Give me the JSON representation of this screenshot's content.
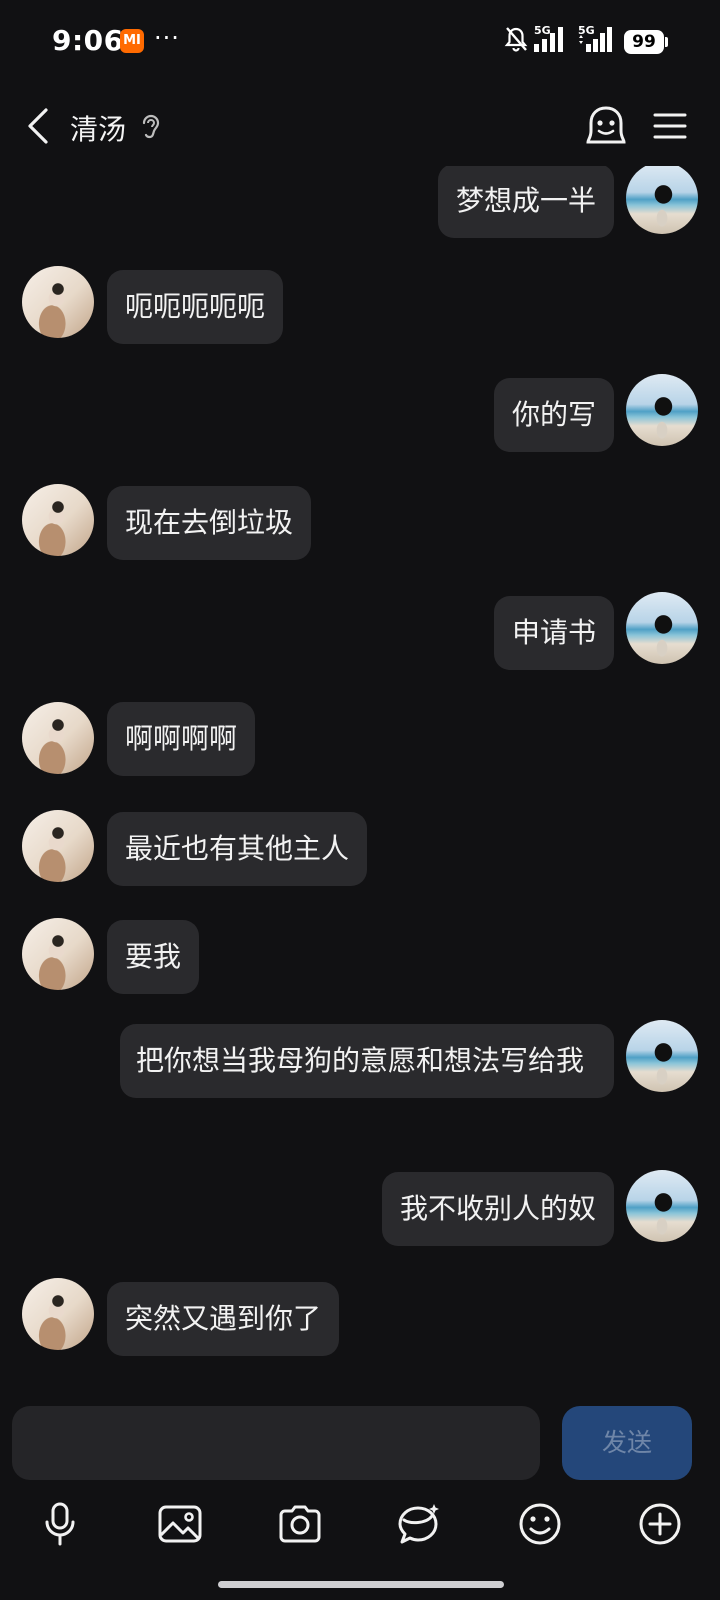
{
  "status_bar": {
    "time": "9:06",
    "carrier_badge": "MI",
    "more_indicator": "···",
    "network_1": "5G",
    "network_2": "5G",
    "battery": "99"
  },
  "header": {
    "contact_name": "清汤",
    "icons": [
      "back-arrow-icon",
      "ear-icon",
      "robot-icon",
      "menu-icon"
    ]
  },
  "messages": [
    {
      "side": "right",
      "text": "梦想成一半"
    },
    {
      "side": "left",
      "text": "呃呃呃呃呃"
    },
    {
      "side": "right",
      "text": "你的写"
    },
    {
      "side": "left",
      "text": "现在去倒垃圾"
    },
    {
      "side": "right",
      "text": "申请书"
    },
    {
      "side": "left",
      "text": "啊啊啊啊"
    },
    {
      "side": "left",
      "text": "最近也有其他主人"
    },
    {
      "side": "left",
      "text": "要我"
    },
    {
      "side": "right",
      "text": "把你想当我母狗的意愿和想法写给我"
    },
    {
      "side": "right",
      "text": "我不收别人的奴"
    },
    {
      "side": "left",
      "text": "突然又遇到你了"
    }
  ],
  "composer": {
    "input_value": "",
    "send_label": "发送"
  },
  "toolbar": {
    "icons": [
      "microphone-icon",
      "image-icon",
      "camera-icon",
      "sticker-icon",
      "emoji-icon",
      "plus-icon"
    ]
  }
}
